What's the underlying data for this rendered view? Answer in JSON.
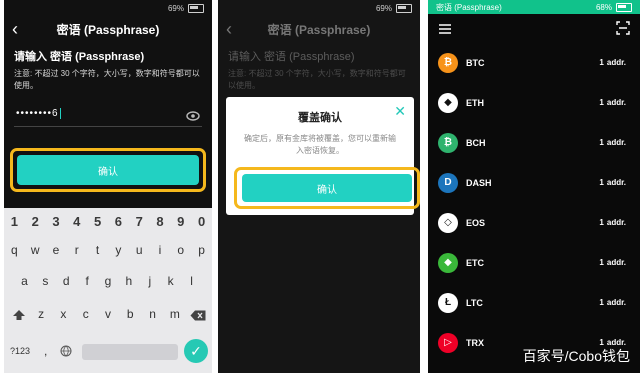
{
  "panel1": {
    "battery": "69%",
    "title": "密语 (Passphrase)",
    "heading": "请输入 密语 (Passphrase)",
    "note": "注意: 不超过 30 个字符，大小写，数字和符号都可以使用。",
    "password_masked": "••••••••6",
    "confirm_label": "确认",
    "keyboard": {
      "numbers": [
        "1",
        "2",
        "3",
        "4",
        "5",
        "6",
        "7",
        "8",
        "9",
        "0"
      ],
      "row1": [
        "q",
        "w",
        "e",
        "r",
        "t",
        "y",
        "u",
        "i",
        "o",
        "p"
      ],
      "row2": [
        "a",
        "s",
        "d",
        "f",
        "g",
        "h",
        "j",
        "k",
        "l"
      ],
      "row3": [
        "z",
        "x",
        "c",
        "v",
        "b",
        "n",
        "m"
      ],
      "mode_key": "?123",
      "comma_key": ","
    }
  },
  "panel2": {
    "battery": "69%",
    "title": "密语 (Passphrase)",
    "heading": "请输入 密语 (Passphrase)",
    "note": "注意: 不超过 30 个字符，大小写，数字和符号都可以使用。",
    "dialog": {
      "title": "覆盖确认",
      "message": "确定后，原有金库将被覆盖，您可以重新输入密语恢复。",
      "confirm_label": "确认"
    }
  },
  "panel3": {
    "status_title": "密语 (Passphrase)",
    "battery": "68%",
    "coins": [
      {
        "symbol": "BTC",
        "count": "1",
        "unit": "addr.",
        "color": "#f7931a",
        "glyph": "₿"
      },
      {
        "symbol": "ETH",
        "count": "1",
        "unit": "addr.",
        "color": "#ffffff",
        "glyph": "◆"
      },
      {
        "symbol": "BCH",
        "count": "1",
        "unit": "addr.",
        "color": "#2fb36e",
        "glyph": "₿"
      },
      {
        "symbol": "DASH",
        "count": "1",
        "unit": "addr.",
        "color": "#1c75bc",
        "glyph": "D"
      },
      {
        "symbol": "EOS",
        "count": "1",
        "unit": "addr.",
        "color": "#ffffff",
        "glyph": "◇"
      },
      {
        "symbol": "ETC",
        "count": "1",
        "unit": "addr.",
        "color": "#3ab83a",
        "glyph": "◆"
      },
      {
        "symbol": "LTC",
        "count": "1",
        "unit": "addr.",
        "color": "#ffffff",
        "glyph": "Ł"
      },
      {
        "symbol": "TRX",
        "count": "1",
        "unit": "addr.",
        "color": "#ef0027",
        "glyph": "▷"
      }
    ]
  },
  "watermark": "百家号/Cobo钱包"
}
